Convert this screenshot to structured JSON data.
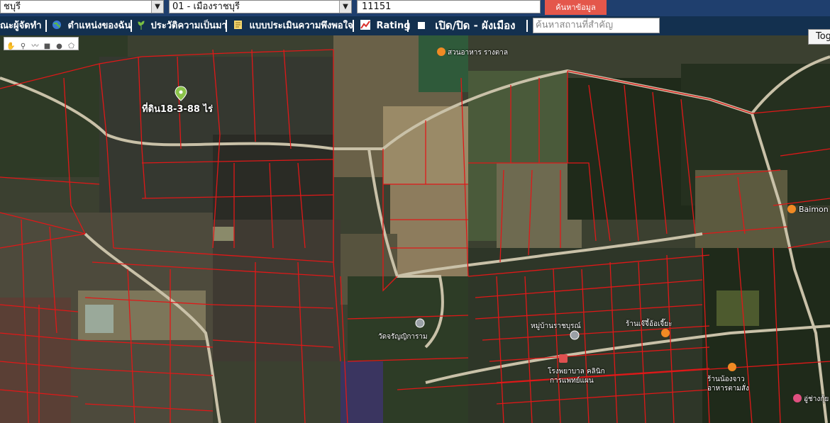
{
  "topbar": {
    "province_select": "ชบุรี",
    "district_select": "01 - เมืองราชบุรี",
    "postcode_value": "11151",
    "search_button": "ค้นหาข้อมูล"
  },
  "menu": {
    "items": [
      {
        "label": "ณะผู้จัดทำ",
        "icon": "users-icon"
      },
      {
        "label": "ตำแหน่งของฉัน",
        "icon": "globe-icon"
      },
      {
        "label": "ประวัติความเป็นมา",
        "icon": "sprout-icon"
      },
      {
        "label": "แบบประเมินความพึงพอใจ",
        "icon": "form-icon"
      },
      {
        "label": "Rating",
        "icon": "chart-icon"
      },
      {
        "label": "เปิด/ปิด - ผังเมือง",
        "icon": "square-icon"
      }
    ],
    "place_search_placeholder": "ค้นหาสถานที่สำคัญ"
  },
  "map": {
    "toggle_button": "Tog",
    "parcel_label": "ที่ดิน18-3-88 ไร่",
    "places": [
      {
        "name": "สวนอาหาร รางตาล"
      },
      {
        "name": "วัดจรัญญิการาม"
      },
      {
        "name": "หมู่บ้านราชบุรณ์"
      },
      {
        "name": "ร้านเจ๊จี้อ้อเจี๊ยะ"
      },
      {
        "name": "โรงพยาบาล คลินิก"
      },
      {
        "name": "การแพทย์แผน"
      },
      {
        "name": "Baimon C"
      },
      {
        "name": "ร้านน้องจาว"
      },
      {
        "name": "อาหารตามสั่ง"
      },
      {
        "name": "อู่ช่างกุ้ย"
      }
    ],
    "colors": {
      "parcel_line": "#e01818",
      "menubar": "#13304f",
      "search_button": "#e4574b"
    }
  }
}
